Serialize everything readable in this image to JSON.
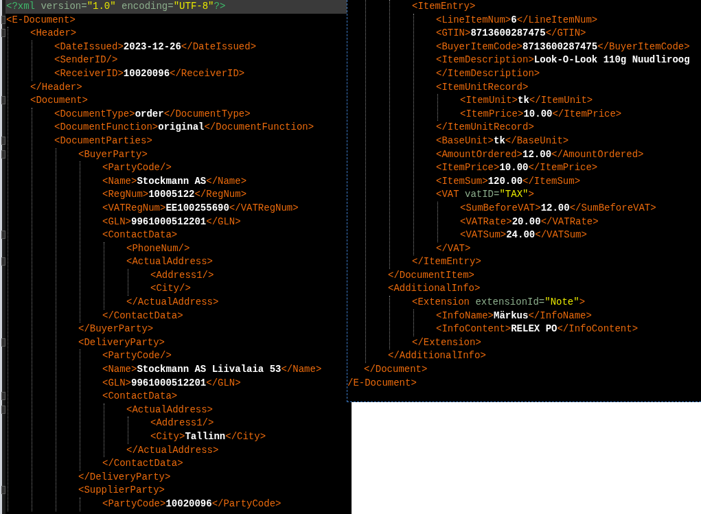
{
  "left_pane": {
    "lines": [
      {
        "current": true,
        "parts": [
          {
            "kind": "pi",
            "text": "<?xml"
          },
          {
            "kind": "attr",
            "text": " version="
          },
          {
            "kind": "string",
            "text": "\"1.0\""
          },
          {
            "kind": "attr",
            "text": " encoding="
          },
          {
            "kind": "string",
            "text": "\"UTF-8\""
          },
          {
            "kind": "pi",
            "text": "?>"
          }
        ]
      },
      {
        "parts": [
          {
            "kind": "tag",
            "text": "<E-Document>"
          }
        ],
        "children": [
          {
            "parts": [
              {
                "kind": "tag",
                "text": "<Header>"
              }
            ],
            "children": [
              {
                "parts": [
                  {
                    "kind": "tag",
                    "text": "<DateIssued>"
                  },
                  {
                    "kind": "text",
                    "text": "2023-12-26"
                  },
                  {
                    "kind": "tag",
                    "text": "</DateIssued>"
                  }
                ]
              },
              {
                "parts": [
                  {
                    "kind": "tag",
                    "text": "<SenderID/>"
                  }
                ]
              },
              {
                "parts": [
                  {
                    "kind": "tag",
                    "text": "<ReceiverID>"
                  },
                  {
                    "kind": "text",
                    "text": "10020096"
                  },
                  {
                    "kind": "tag",
                    "text": "</ReceiverID>"
                  }
                ]
              }
            ]
          },
          {
            "parts": [
              {
                "kind": "tag",
                "text": "</Header>"
              }
            ]
          },
          {
            "parts": [
              {
                "kind": "tag",
                "text": "<Document>"
              }
            ],
            "children": [
              {
                "parts": [
                  {
                    "kind": "tag",
                    "text": "<DocumentType>"
                  },
                  {
                    "kind": "text",
                    "text": "order"
                  },
                  {
                    "kind": "tag",
                    "text": "</DocumentType>"
                  }
                ]
              },
              {
                "parts": [
                  {
                    "kind": "tag",
                    "text": "<DocumentFunction>"
                  },
                  {
                    "kind": "text",
                    "text": "original"
                  },
                  {
                    "kind": "tag",
                    "text": "</DocumentFunction>"
                  }
                ]
              },
              {
                "parts": [
                  {
                    "kind": "tag",
                    "text": "<DocumentParties>"
                  }
                ],
                "children": [
                  {
                    "parts": [
                      {
                        "kind": "tag",
                        "text": "<BuyerParty>"
                      }
                    ],
                    "children": [
                      {
                        "parts": [
                          {
                            "kind": "tag",
                            "text": "<PartyCode/>"
                          }
                        ]
                      },
                      {
                        "parts": [
                          {
                            "kind": "tag",
                            "text": "<Name>"
                          },
                          {
                            "kind": "text",
                            "text": "Stockmann AS"
                          },
                          {
                            "kind": "tag",
                            "text": "</Name>"
                          }
                        ]
                      },
                      {
                        "parts": [
                          {
                            "kind": "tag",
                            "text": "<RegNum>"
                          },
                          {
                            "kind": "text",
                            "text": "10005122"
                          },
                          {
                            "kind": "tag",
                            "text": "</RegNum>"
                          }
                        ]
                      },
                      {
                        "parts": [
                          {
                            "kind": "tag",
                            "text": "<VATRegNum>"
                          },
                          {
                            "kind": "text",
                            "text": "EE100255690"
                          },
                          {
                            "kind": "tag",
                            "text": "</VATRegNum>"
                          }
                        ]
                      },
                      {
                        "parts": [
                          {
                            "kind": "tag",
                            "text": "<GLN>"
                          },
                          {
                            "kind": "text",
                            "text": "9961000512201"
                          },
                          {
                            "kind": "tag",
                            "text": "</GLN>"
                          }
                        ]
                      },
                      {
                        "parts": [
                          {
                            "kind": "tag",
                            "text": "<ContactData>"
                          }
                        ],
                        "children": [
                          {
                            "parts": [
                              {
                                "kind": "tag",
                                "text": "<PhoneNum/>"
                              }
                            ]
                          },
                          {
                            "parts": [
                              {
                                "kind": "tag",
                                "text": "<ActualAddress>"
                              }
                            ],
                            "children": [
                              {
                                "parts": [
                                  {
                                    "kind": "tag",
                                    "text": "<Address1/>"
                                  }
                                ]
                              },
                              {
                                "parts": [
                                  {
                                    "kind": "tag",
                                    "text": "<City/>"
                                  }
                                ]
                              }
                            ]
                          },
                          {
                            "parts": [
                              {
                                "kind": "tag",
                                "text": "</ActualAddress>"
                              }
                            ]
                          }
                        ]
                      },
                      {
                        "parts": [
                          {
                            "kind": "tag",
                            "text": "</ContactData>"
                          }
                        ]
                      }
                    ]
                  },
                  {
                    "parts": [
                      {
                        "kind": "tag",
                        "text": "</BuyerParty>"
                      }
                    ]
                  },
                  {
                    "parts": [
                      {
                        "kind": "tag",
                        "text": "<DeliveryParty>"
                      }
                    ],
                    "children": [
                      {
                        "parts": [
                          {
                            "kind": "tag",
                            "text": "<PartyCode/>"
                          }
                        ]
                      },
                      {
                        "parts": [
                          {
                            "kind": "tag",
                            "text": "<Name>"
                          },
                          {
                            "kind": "text",
                            "text": "Stockmann AS Liivalaia 53"
                          },
                          {
                            "kind": "tag",
                            "text": "</Name>"
                          }
                        ]
                      },
                      {
                        "parts": [
                          {
                            "kind": "tag",
                            "text": "<GLN>"
                          },
                          {
                            "kind": "text",
                            "text": "9961000512201"
                          },
                          {
                            "kind": "tag",
                            "text": "</GLN>"
                          }
                        ]
                      },
                      {
                        "parts": [
                          {
                            "kind": "tag",
                            "text": "<ContactData>"
                          }
                        ],
                        "children": [
                          {
                            "parts": [
                              {
                                "kind": "tag",
                                "text": "<ActualAddress>"
                              }
                            ],
                            "children": [
                              {
                                "parts": [
                                  {
                                    "kind": "tag",
                                    "text": "<Address1/>"
                                  }
                                ]
                              },
                              {
                                "parts": [
                                  {
                                    "kind": "tag",
                                    "text": "<City>"
                                  },
                                  {
                                    "kind": "text",
                                    "text": "Tallinn"
                                  },
                                  {
                                    "kind": "tag",
                                    "text": "</City>"
                                  }
                                ]
                              }
                            ]
                          },
                          {
                            "parts": [
                              {
                                "kind": "tag",
                                "text": "</ActualAddress>"
                              }
                            ]
                          }
                        ]
                      },
                      {
                        "parts": [
                          {
                            "kind": "tag",
                            "text": "</ContactData>"
                          }
                        ]
                      }
                    ]
                  },
                  {
                    "parts": [
                      {
                        "kind": "tag",
                        "text": "</DeliveryParty>"
                      }
                    ]
                  },
                  {
                    "parts": [
                      {
                        "kind": "tag",
                        "text": "<SupplierParty>"
                      }
                    ],
                    "children": [
                      {
                        "parts": [
                          {
                            "kind": "tag",
                            "text": "<PartyCode>"
                          },
                          {
                            "kind": "text",
                            "text": "10020096"
                          },
                          {
                            "kind": "tag",
                            "text": "</PartyCode>"
                          }
                        ]
                      }
                    ]
                  }
                ]
              }
            ]
          }
        ]
      }
    ]
  },
  "right_pane": {
    "lines": [
      {
        "children": [
          {
            "children": [
              {
                "children": [
                  {
                    "parts": [
                      {
                        "kind": "tag",
                        "text": "<ItemEntry>"
                      }
                    ],
                    "children": [
                      {
                        "parts": [
                          {
                            "kind": "tag",
                            "text": "<LineItemNum>"
                          },
                          {
                            "kind": "text",
                            "text": "6"
                          },
                          {
                            "kind": "tag",
                            "text": "</LineItemNum>"
                          }
                        ]
                      },
                      {
                        "parts": [
                          {
                            "kind": "tag",
                            "text": "<GTIN>"
                          },
                          {
                            "kind": "text",
                            "text": "8713600287475"
                          },
                          {
                            "kind": "tag",
                            "text": "</GTIN>"
                          }
                        ]
                      },
                      {
                        "parts": [
                          {
                            "kind": "tag",
                            "text": "<BuyerItemCode>"
                          },
                          {
                            "kind": "text",
                            "text": "8713600287475"
                          },
                          {
                            "kind": "tag",
                            "text": "</BuyerItemCode>"
                          }
                        ]
                      },
                      {
                        "parts": [
                          {
                            "kind": "tag",
                            "text": "<ItemDescription>"
                          },
                          {
                            "kind": "text",
                            "text": "Look-O-Look 110g Nuudliroog"
                          }
                        ]
                      },
                      {
                        "parts": [
                          {
                            "kind": "tag",
                            "text": "</ItemDescription>"
                          }
                        ]
                      },
                      {
                        "parts": [
                          {
                            "kind": "tag",
                            "text": "<ItemUnitRecord>"
                          }
                        ],
                        "children": [
                          {
                            "parts": [
                              {
                                "kind": "tag",
                                "text": "<ItemUnit>"
                              },
                              {
                                "kind": "text",
                                "text": "tk"
                              },
                              {
                                "kind": "tag",
                                "text": "</ItemUnit>"
                              }
                            ]
                          },
                          {
                            "parts": [
                              {
                                "kind": "tag",
                                "text": "<ItemPrice>"
                              },
                              {
                                "kind": "text",
                                "text": "10.00"
                              },
                              {
                                "kind": "tag",
                                "text": "</ItemPrice>"
                              }
                            ]
                          }
                        ]
                      },
                      {
                        "parts": [
                          {
                            "kind": "tag",
                            "text": "</ItemUnitRecord>"
                          }
                        ]
                      },
                      {
                        "parts": [
                          {
                            "kind": "tag",
                            "text": "<BaseUnit>"
                          },
                          {
                            "kind": "text",
                            "text": "tk"
                          },
                          {
                            "kind": "tag",
                            "text": "</BaseUnit>"
                          }
                        ]
                      },
                      {
                        "parts": [
                          {
                            "kind": "tag",
                            "text": "<AmountOrdered>"
                          },
                          {
                            "kind": "text",
                            "text": "12.00"
                          },
                          {
                            "kind": "tag",
                            "text": "</AmountOrdered>"
                          }
                        ]
                      },
                      {
                        "parts": [
                          {
                            "kind": "tag",
                            "text": "<ItemPrice>"
                          },
                          {
                            "kind": "text",
                            "text": "10.00"
                          },
                          {
                            "kind": "tag",
                            "text": "</ItemPrice>"
                          }
                        ]
                      },
                      {
                        "parts": [
                          {
                            "kind": "tag",
                            "text": "<ItemSum>"
                          },
                          {
                            "kind": "text",
                            "text": "120.00"
                          },
                          {
                            "kind": "tag",
                            "text": "</ItemSum>"
                          }
                        ]
                      },
                      {
                        "parts": [
                          {
                            "kind": "tag",
                            "text": "<VAT"
                          },
                          {
                            "kind": "attr",
                            "text": " vatID="
                          },
                          {
                            "kind": "string",
                            "text": "\"TAX\""
                          },
                          {
                            "kind": "tag",
                            "text": ">"
                          }
                        ],
                        "children": [
                          {
                            "parts": [
                              {
                                "kind": "tag",
                                "text": "<SumBeforeVAT>"
                              },
                              {
                                "kind": "text",
                                "text": "12.00"
                              },
                              {
                                "kind": "tag",
                                "text": "</SumBeforeVAT>"
                              }
                            ]
                          },
                          {
                            "parts": [
                              {
                                "kind": "tag",
                                "text": "<VATRate>"
                              },
                              {
                                "kind": "text",
                                "text": "20.00"
                              },
                              {
                                "kind": "tag",
                                "text": "</VATRate>"
                              }
                            ]
                          },
                          {
                            "parts": [
                              {
                                "kind": "tag",
                                "text": "<VATSum>"
                              },
                              {
                                "kind": "text",
                                "text": "24.00"
                              },
                              {
                                "kind": "tag",
                                "text": "</VATSum>"
                              }
                            ]
                          }
                        ]
                      },
                      {
                        "parts": [
                          {
                            "kind": "tag",
                            "text": "</VAT>"
                          }
                        ]
                      }
                    ]
                  },
                  {
                    "parts": [
                      {
                        "kind": "tag",
                        "text": "</ItemEntry>"
                      }
                    ]
                  }
                ]
              },
              {
                "parts": [
                  {
                    "kind": "tag",
                    "text": "</DocumentItem>"
                  }
                ]
              },
              {
                "parts": [
                  {
                    "kind": "tag",
                    "text": "<AdditionalInfo>"
                  }
                ],
                "children": [
                  {
                    "parts": [
                      {
                        "kind": "tag",
                        "text": "<Extension"
                      },
                      {
                        "kind": "attr",
                        "text": " extensionId="
                      },
                      {
                        "kind": "string",
                        "text": "\"Note\""
                      },
                      {
                        "kind": "tag",
                        "text": ">"
                      }
                    ],
                    "children": [
                      {
                        "parts": [
                          {
                            "kind": "tag",
                            "text": "<InfoName>"
                          },
                          {
                            "kind": "text",
                            "text": "Märkus"
                          },
                          {
                            "kind": "tag",
                            "text": "</InfoName>"
                          }
                        ]
                      },
                      {
                        "parts": [
                          {
                            "kind": "tag",
                            "text": "<InfoContent>"
                          },
                          {
                            "kind": "text",
                            "text": "RELEX PO"
                          },
                          {
                            "kind": "tag",
                            "text": "</InfoContent>"
                          }
                        ]
                      }
                    ]
                  },
                  {
                    "parts": [
                      {
                        "kind": "tag",
                        "text": "</Extension>"
                      }
                    ]
                  }
                ]
              },
              {
                "parts": [
                  {
                    "kind": "tag",
                    "text": "</AdditionalInfo>"
                  }
                ]
              }
            ]
          },
          {
            "parts": [
              {
                "kind": "tag",
                "text": "</Document>"
              }
            ]
          }
        ]
      },
      {
        "parts": [
          {
            "kind": "tag",
            "text": "/E-Document>"
          }
        ]
      }
    ]
  }
}
